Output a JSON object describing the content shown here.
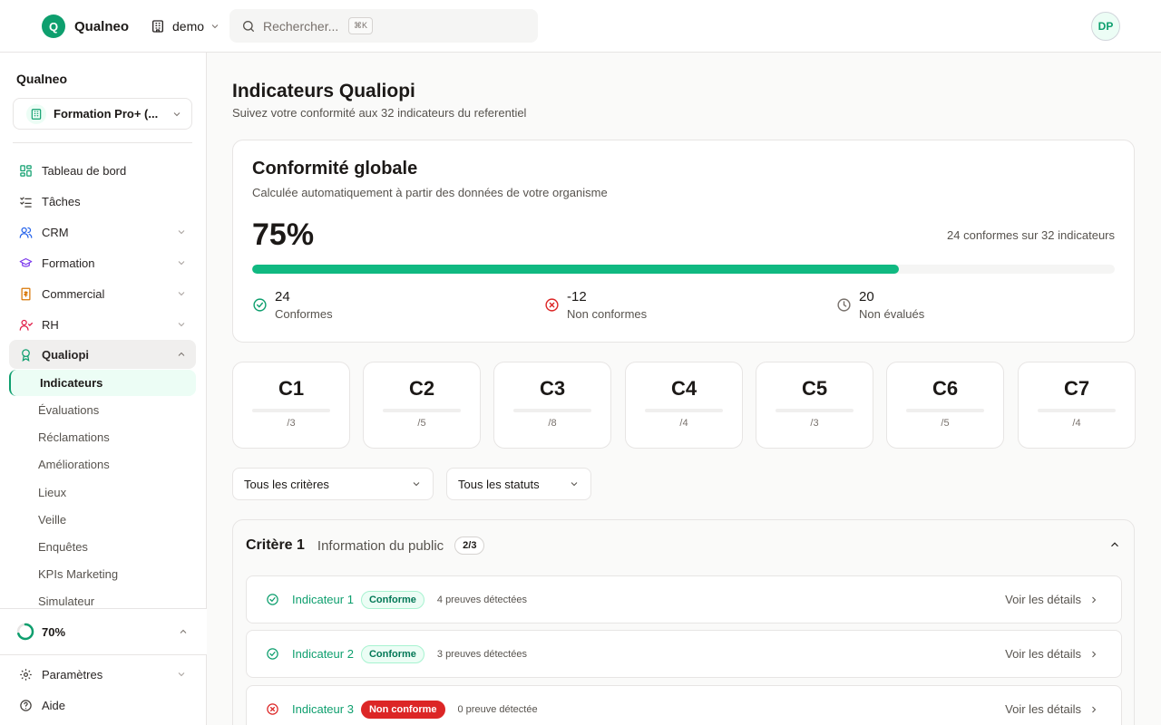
{
  "topbar": {
    "brand_initial": "Q",
    "brand_name": "Qualneo",
    "workspace": "demo",
    "search_placeholder": "Rechercher...",
    "search_shortcut": "⌘K",
    "avatar_initials": "DP"
  },
  "sidebar": {
    "org_title": "Qualneo",
    "org_selected": "Formation Pro+ (...",
    "items": [
      {
        "label": "Tableau de bord",
        "icon": "dashboard-icon"
      },
      {
        "label": "Tâches",
        "icon": "tasks-icon"
      },
      {
        "label": "CRM",
        "icon": "users-icon"
      },
      {
        "label": "Formation",
        "icon": "graduation-cap-icon"
      },
      {
        "label": "Commercial",
        "icon": "receipt-icon"
      },
      {
        "label": "RH",
        "icon": "team-icon"
      },
      {
        "label": "Qualiopi",
        "icon": "award-icon"
      }
    ],
    "qualiopi_sub": [
      "Indicateurs",
      "Évaluations",
      "Réclamations",
      "Améliorations",
      "Lieux",
      "Veille",
      "Enquêtes",
      "KPIs Marketing",
      "Simulateur"
    ],
    "progress_label": "70%",
    "progress_value": 0.7,
    "settings_label": "Paramètres",
    "help_label": "Aide"
  },
  "main": {
    "title": "Indicateurs Qualiopi",
    "subtitle": "Suivez votre conformité aux 32 indicateurs du referentiel",
    "overall": {
      "title": "Conformité globale",
      "subtitle": "Calculée automatiquement à partir des données de votre organisme",
      "percent_label": "75%",
      "percent_value": 75,
      "summary": "24 conformes sur 32 indicateurs",
      "stats": [
        {
          "value": "24",
          "label": "Conformes",
          "icon": "check-circle-icon",
          "color": "#0e9f6e"
        },
        {
          "value": "-12",
          "label": "Non conformes",
          "icon": "x-circle-icon",
          "color": "#dc2626"
        },
        {
          "value": "20",
          "label": "Non évalués",
          "icon": "clock-icon",
          "color": "#78716c"
        }
      ]
    },
    "criteria": [
      {
        "code": "C1",
        "denominator": "/3"
      },
      {
        "code": "C2",
        "denominator": "/5"
      },
      {
        "code": "C3",
        "denominator": "/8"
      },
      {
        "code": "C4",
        "denominator": "/4"
      },
      {
        "code": "C5",
        "denominator": "/3"
      },
      {
        "code": "C6",
        "denominator": "/5"
      },
      {
        "code": "C7",
        "denominator": "/4"
      }
    ],
    "filters": {
      "criteria": "Tous les critères",
      "status": "Tous les statuts"
    },
    "group": {
      "title": "Critère 1",
      "name": "Information du public",
      "count": "2/3",
      "indicators": [
        {
          "name": "Indicateur 1",
          "status": "Conforme",
          "status_kind": "ok",
          "proofs": "4 preuves détectées",
          "action": "Voir les détails"
        },
        {
          "name": "Indicateur 2",
          "status": "Conforme",
          "status_kind": "ok",
          "proofs": "3 preuves détectées",
          "action": "Voir les détails"
        },
        {
          "name": "Indicateur 3",
          "status": "Non conforme",
          "status_kind": "ko",
          "proofs": "0 preuve détectée",
          "action": "Voir les détails"
        }
      ]
    }
  },
  "colors": {
    "accent": "#0e9f6e",
    "danger": "#dc2626",
    "bar": "#10b981"
  }
}
